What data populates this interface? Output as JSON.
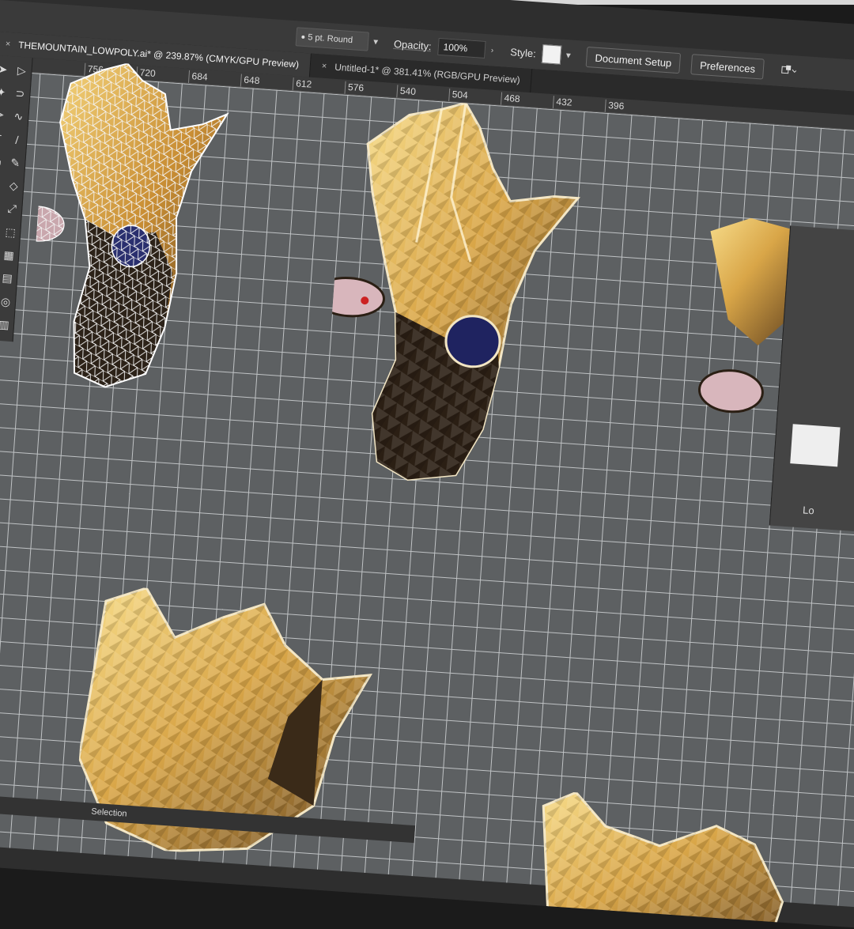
{
  "control_bar": {
    "stroke_profile": "5 pt. Round",
    "opacity_label": "Opacity:",
    "opacity_value": "100%",
    "style_label": "Style:",
    "document_setup_label": "Document Setup",
    "preferences_label": "Preferences"
  },
  "tabs": [
    {
      "label": "THEMOUNTAIN_LOWPOLY.ai* @ 239.87% (CMYK/GPU Preview)",
      "close": "×"
    },
    {
      "label": "Untitled-1* @ 381.41% (RGB/GPU Preview)",
      "close": "×"
    }
  ],
  "ruler": {
    "ticks": [
      "756",
      "720",
      "684",
      "648",
      "612",
      "576",
      "540",
      "504",
      "468",
      "432",
      "396"
    ]
  },
  "toolbar": {
    "tools": [
      "selection",
      "direct-selection",
      "magic-wand",
      "lasso",
      "pen",
      "curvature",
      "type",
      "line",
      "rectangle",
      "paintbrush",
      "shaper",
      "pencil",
      "eraser",
      "rotate",
      "scale",
      "width",
      "free-transform",
      "shape-builder",
      "perspective",
      "mesh",
      "gradient",
      "eyedropper",
      "blend",
      "symbol",
      "graph",
      "artboard"
    ]
  },
  "status_bar": {
    "tool": "Selection"
  },
  "panel": {
    "partial_label": "Lo"
  },
  "colors": {
    "canvas": "#5d6062",
    "grid": "#bfc2c4",
    "gold": "#d9a648",
    "dark_brown": "#3a2a18",
    "eye_blue": "#2a2f6e"
  }
}
